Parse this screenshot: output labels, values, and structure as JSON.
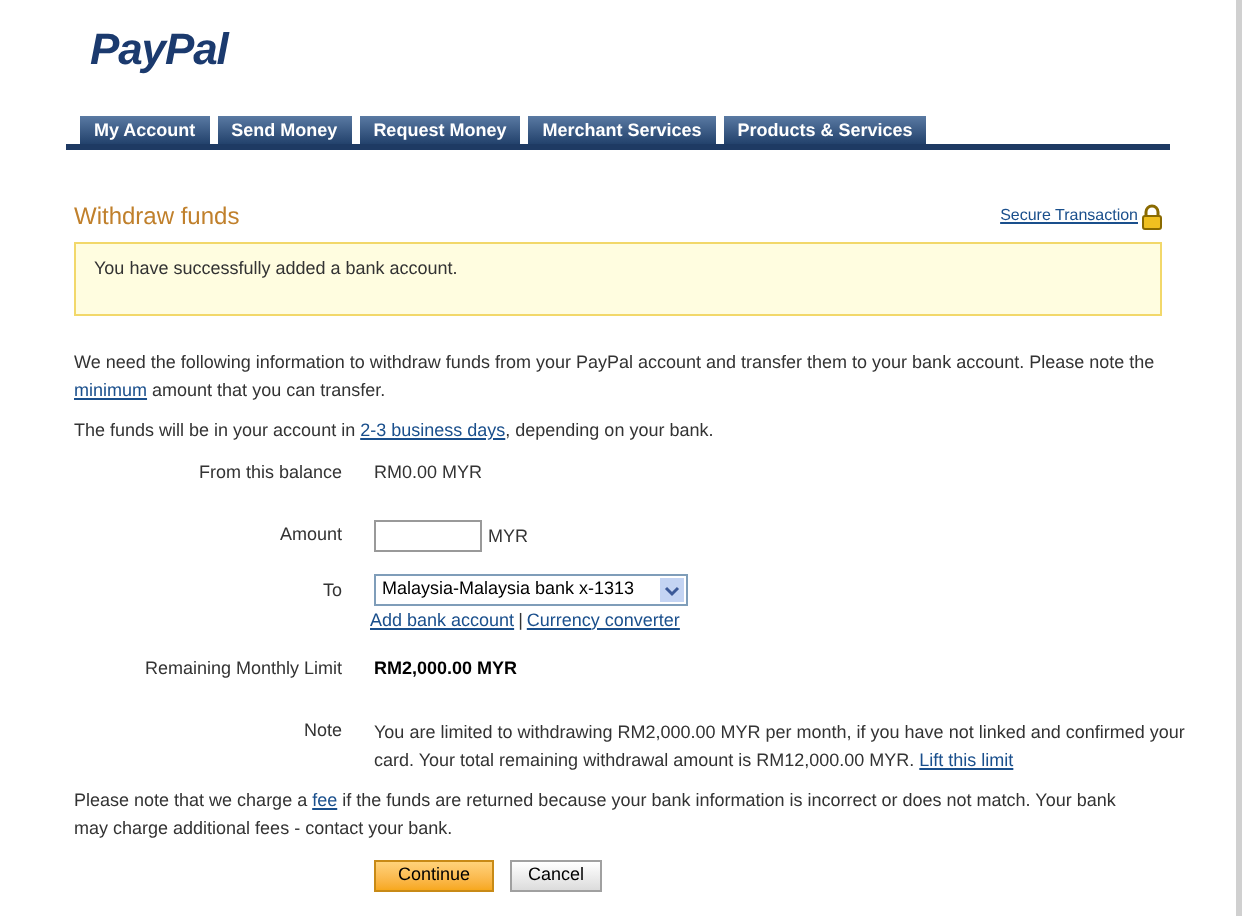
{
  "logo": "PayPal",
  "tabs": [
    "My Account",
    "Send Money",
    "Request Money",
    "Merchant Services",
    "Products & Services"
  ],
  "heading": "Withdraw funds",
  "secure_link": "Secure Transaction",
  "notice": "You have successfully added a bank account.",
  "intro": {
    "before": "We need the following information to withdraw funds from your PayPal account and transfer them to your bank account. Please note the",
    "link": "minimum",
    "after": "amount that you can transfer."
  },
  "timing": {
    "before": "The funds will be in your account in",
    "link": "2-3 business days",
    "after": ", depending on your bank."
  },
  "form": {
    "balance_label": "From this balance",
    "balance": "RM0.00 MYR",
    "amount_label": "Amount",
    "amount_currency": "MYR",
    "to_label": "To",
    "to_value": "Malaysia-Malaysia bank x-1313",
    "links": [
      "Add bank account",
      "Currency converter"
    ],
    "separator": "|",
    "limit_label": "Remaining Monthly Limit",
    "limit": "RM2,000.00 MYR",
    "note_label": "Note",
    "note": "You are limited to withdrawing RM2,000.00 MYR per month, if you have not linked and confirmed your card. Your total remaining withdrawal amount is RM12,000.00 MYR.",
    "note_link": "Lift this limit"
  },
  "fee_note": {
    "before": "Please note that we charge a",
    "link": "fee",
    "after": "if the funds are returned because your bank information is incorrect or does not match. Your bank may charge additional fees - contact your bank."
  },
  "buttons": {
    "continue": "Continue",
    "cancel": "Cancel"
  }
}
